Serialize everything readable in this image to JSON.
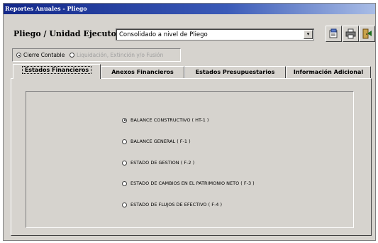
{
  "window": {
    "title": "Reportes Anuales - Pliego"
  },
  "header": {
    "label": "Pliego / Unidad Ejecutora :",
    "combo_value": "Consolidado a nivel de Pliego",
    "combo_arrow": "▾"
  },
  "toolbar": {
    "buttons": [
      {
        "icon": "report-icon",
        "label": ""
      },
      {
        "icon": "printer-icon",
        "label": ""
      },
      {
        "icon": "exit-icon",
        "label": ""
      }
    ]
  },
  "mode": {
    "options": [
      {
        "label": "Cierre Contable",
        "selected": true,
        "enabled": true
      },
      {
        "label": "Liquidación, Extinción y/o Fusión",
        "selected": false,
        "enabled": false
      }
    ]
  },
  "tabs": [
    {
      "label": "Estados Financieros",
      "active": true
    },
    {
      "label": "Anexos Financieros",
      "active": false
    },
    {
      "label": "Estados Presupuestarios",
      "active": false
    },
    {
      "label": "Información Adicional",
      "active": false
    }
  ],
  "reports": [
    {
      "label": "BALANCE CONSTRUCTIVO ( HT-1 )",
      "selected": true
    },
    {
      "label": "BALANCE GENERAL ( F-1   )",
      "selected": false
    },
    {
      "label": "ESTADO DE GESTION ( F-2   )",
      "selected": false
    },
    {
      "label": "ESTADO DE CAMBIOS EN EL PATRIMONIO NETO ( F-3   )",
      "selected": false
    },
    {
      "label": "ESTADO DE FLUJOS DE EFECTIVO ( F-4   )",
      "selected": false
    }
  ]
}
